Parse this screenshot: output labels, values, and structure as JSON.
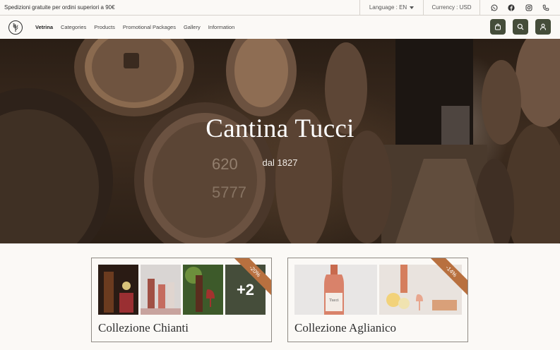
{
  "topbar": {
    "promo": "Spedizioni gratuite per ordini superiori a 90€",
    "language": "Language : EN",
    "currency": "Currency : USD",
    "social_icons": [
      "whatsapp-icon",
      "facebook-icon",
      "instagram-icon",
      "phone-icon"
    ]
  },
  "nav": {
    "items": [
      "Vetrina",
      "Categories",
      "Products",
      "Promotional Packages",
      "Gallery",
      "Information"
    ],
    "active": "Vetrina",
    "actions": [
      "bag-icon",
      "search-icon",
      "user-icon"
    ]
  },
  "hero": {
    "title": "Cantina Tucci",
    "subtitle": "dal 1827"
  },
  "collections": [
    {
      "title": "Collezione Chianti",
      "discount": "-20%",
      "more": "+2"
    },
    {
      "title": "Collezione Aglianico",
      "discount": "-14%"
    }
  ],
  "colors": {
    "accent": "#454d3a",
    "ribbon": "#b8703f",
    "background": "#fbf9f6"
  }
}
